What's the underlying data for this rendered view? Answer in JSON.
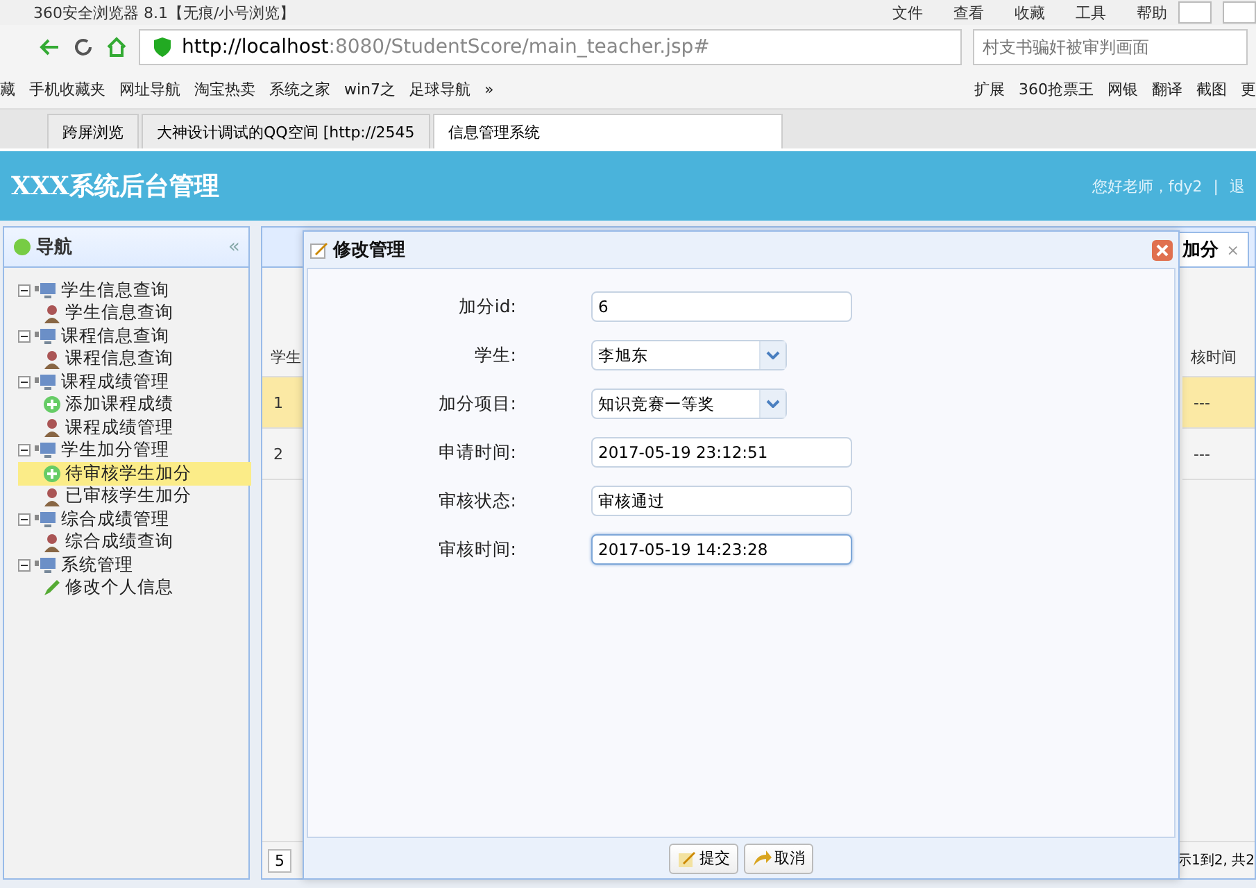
{
  "browser": {
    "title": "360安全浏览器 8.1【无痕/小号浏览】",
    "menu": [
      "文件",
      "查看",
      "收藏",
      "工具",
      "帮助"
    ],
    "url_host": "http://localhost",
    "url_rest": ":8080/StudentScore/main_teacher.jsp#",
    "search": "村支书骗奸被审判画面",
    "bookmarks": [
      "藏",
      "手机收藏夹",
      "网址导航",
      "淘宝热卖",
      "系统之家",
      "win7之",
      "足球导航",
      "»"
    ],
    "extensions": [
      "扩展",
      "360抢票王",
      "网银",
      "翻译",
      "截图",
      "更"
    ],
    "tabs": [
      {
        "label": "跨屏浏览",
        "selected": false
      },
      {
        "label": "大神设计调试的QQ空间 [http://2545",
        "selected": false
      },
      {
        "label": "信息管理系统",
        "selected": true
      }
    ]
  },
  "header": {
    "title": "XXX系统后台管理",
    "greeting": "您好老师，fdy2",
    "separator": "|",
    "cut": "退"
  },
  "sidebar": {
    "title": "导航",
    "collapse": "«",
    "items": [
      {
        "label": "学生信息查询",
        "children": [
          {
            "label": "学生信息查询",
            "kind": "person",
            "selected": false
          }
        ]
      },
      {
        "label": "课程信息查询",
        "children": [
          {
            "label": "课程信息查询",
            "kind": "person",
            "selected": false
          }
        ]
      },
      {
        "label": "课程成绩管理",
        "children": [
          {
            "label": "添加课程成绩",
            "kind": "add",
            "selected": false
          },
          {
            "label": "课程成绩管理",
            "kind": "person",
            "selected": false
          }
        ]
      },
      {
        "label": "学生加分管理",
        "children": [
          {
            "label": "待审核学生加分",
            "kind": "add",
            "selected": true
          },
          {
            "label": "已审核学生加分",
            "kind": "person",
            "selected": false
          }
        ]
      },
      {
        "label": "综合成绩管理",
        "children": [
          {
            "label": "综合成绩查询",
            "kind": "person",
            "selected": false
          }
        ]
      },
      {
        "label": "系统管理",
        "children": [
          {
            "label": "修改个人信息",
            "kind": "edit",
            "selected": false
          }
        ]
      }
    ]
  },
  "background": {
    "tab": "加分",
    "tab_close": "×",
    "column_1": "学生",
    "column_last": "核时间",
    "rows": [
      {
        "number": "1",
        "last": "---",
        "selected": true
      },
      {
        "number": "2",
        "last": "---",
        "selected": false
      }
    ],
    "page_size": "5",
    "pager_text": "示1到2, 共2"
  },
  "dialog": {
    "title": "修改管理",
    "fields": [
      {
        "label": "加分id:",
        "kind": "text",
        "value": "6",
        "focused": false
      },
      {
        "label": "学生:",
        "kind": "select",
        "value": "李旭东",
        "focused": false
      },
      {
        "label": "加分项目:",
        "kind": "select",
        "value": "知识竞赛一等奖",
        "focused": false
      },
      {
        "label": "申请时间:",
        "kind": "text",
        "value": "2017-05-19 23:12:51",
        "focused": false
      },
      {
        "label": "审核状态:",
        "kind": "text",
        "value": "审核通过",
        "focused": false
      },
      {
        "label": "审核时间:",
        "kind": "text",
        "value": "2017-05-19 14:23:28",
        "focused": true
      }
    ],
    "buttons": [
      {
        "label": "提交",
        "kind": "submit"
      },
      {
        "label": "取消",
        "kind": "cancel"
      }
    ]
  }
}
